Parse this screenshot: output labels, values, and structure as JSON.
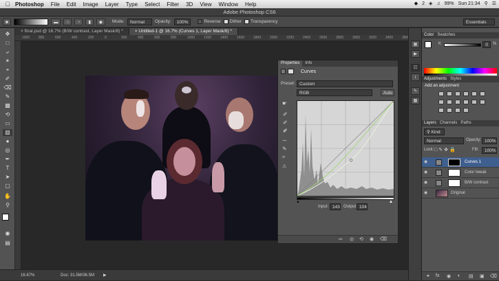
{
  "menubar": {
    "apple": "",
    "app_name": "Photoshop",
    "items": [
      "File",
      "Edit",
      "Image",
      "Layer",
      "Type",
      "Select",
      "Filter",
      "3D",
      "View",
      "Window",
      "Help"
    ],
    "status_battery": "99%",
    "status_time": "Sun 21:34",
    "status_badge": "2"
  },
  "window": {
    "title": "Adobe Photoshop CS6"
  },
  "options": {
    "mode_label": "Mode:",
    "mode_value": "Normal",
    "opacity_label": "Opacity:",
    "opacity_value": "100%",
    "reverse_label": "Reverse",
    "dither_label": "Dither",
    "transparency_label": "Transparency",
    "workspace": "Essentials"
  },
  "tabs": [
    {
      "label": "final.psd @ 16.7% (B/W contrast, Layer Mask/8) *"
    },
    {
      "label": "Untitled-1 @ 16.7% (Curves 1, Layer Mask/8) *"
    }
  ],
  "ruler_ticks": [
    "1000",
    "800",
    "600",
    "400",
    "200",
    "0",
    "200",
    "400",
    "600",
    "800",
    "1000",
    "1200",
    "1400",
    "1600",
    "1800",
    "2000",
    "2200",
    "2400",
    "2600",
    "2800",
    "3000",
    "3200",
    "3400",
    "3600"
  ],
  "properties": {
    "tabs": [
      "Properties",
      "Info"
    ],
    "title": "Curves",
    "preset_label": "Preset:",
    "preset_value": "Custom",
    "channel_value": "RGB",
    "auto_label": "Auto",
    "input_label": "Input:",
    "input_value": "143",
    "output_label": "Output:",
    "output_value": "104"
  },
  "color_panel": {
    "tabs": [
      "Color",
      "Swatches"
    ],
    "k_label": "K",
    "k_value": "0",
    "k_unit": "%"
  },
  "adjustments_panel": {
    "tabs": [
      "Adjustments",
      "Styles"
    ],
    "add_label": "Add an adjustment"
  },
  "layers_panel": {
    "tabs": [
      "Layers",
      "Channels",
      "Paths"
    ],
    "kind_label": "Kind",
    "blend_mode": "Normal",
    "opacity_label": "Opacity:",
    "opacity_value": "100%",
    "lock_label": "Lock:",
    "fill_label": "Fill:",
    "fill_value": "100%",
    "layers": [
      {
        "name": "Curves 1",
        "selected": true
      },
      {
        "name": "Color tweak",
        "selected": false
      },
      {
        "name": "B/W contrast",
        "selected": false
      },
      {
        "name": "Original",
        "selected": false
      }
    ]
  },
  "status": {
    "zoom": "16.67%",
    "doc": "Doc: 31.5M/36.5M"
  },
  "colors": {
    "accent_selected": "#3f5f8e",
    "panel_bg": "#535353",
    "app_bg": "#282828"
  }
}
